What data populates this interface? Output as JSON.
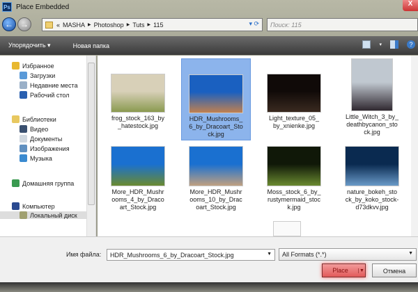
{
  "window": {
    "title": "Place Embedded",
    "app_icon": "Ps",
    "close": "X"
  },
  "address": {
    "crumbs": [
      "«",
      "MASHA",
      "Photoshop",
      "Tuts",
      "115"
    ],
    "search_placeholder": "Поиск: 115"
  },
  "toolbar": {
    "organize": "Упорядочить ▾",
    "new_folder": "Новая папка"
  },
  "sidebar": {
    "items": [
      {
        "label": "Избранное",
        "icon": "star-icon",
        "color": "#e8b830"
      },
      {
        "label": "Загрузки",
        "icon": "downloads-icon",
        "color": "#5a9ad8"
      },
      {
        "label": "Недавние места",
        "icon": "recent-places-icon",
        "color": "#9ab0c8"
      },
      {
        "label": "Рабочий стол",
        "icon": "desktop-icon",
        "color": "#2a60b0"
      },
      {
        "label": "Библиотеки",
        "icon": "libraries-icon",
        "color": "#e8c860"
      },
      {
        "label": "Видео",
        "icon": "video-icon",
        "color": "#3a5070"
      },
      {
        "label": "Документы",
        "icon": "documents-icon",
        "color": "#d0d8e0"
      },
      {
        "label": "Изображения",
        "icon": "pictures-icon",
        "color": "#6090c0"
      },
      {
        "label": "Музыка",
        "icon": "music-icon",
        "color": "#3a8ad0"
      },
      {
        "label": "Домашняя группа",
        "icon": "homegroup-icon",
        "color": "#3a9a50"
      },
      {
        "label": "Компьютер",
        "icon": "computer-icon",
        "color": "#2a4a90"
      },
      {
        "label": "Локальный диск",
        "icon": "local-disk-icon",
        "color": "#a0a070"
      }
    ]
  },
  "files": [
    {
      "name": "frog_stock_163_by _hatestock.jpg",
      "colors": [
        "#d8d0b8",
        "#8a9a50"
      ]
    },
    {
      "name": "HDR_Mushrooms_ 6_by_Dracoart_Sto ck.jpg",
      "colors": [
        "#1a60c0",
        "#c08050"
      ],
      "selected": true
    },
    {
      "name": "Light_texture_05_ by_xnienke.jpg",
      "colors": [
        "#100a08",
        "#3a2a20"
      ]
    },
    {
      "name": "Little_Witch_3_by_ deathbycanon_sto ck.jpg",
      "colors": [
        "#c0c8d0",
        "#302830"
      ]
    },
    {
      "name": "More_HDR_Mushr ooms_4_by_Draco art_Stock.jpg",
      "colors": [
        "#1a70d0",
        "#6a8a30"
      ]
    },
    {
      "name": "More_HDR_Mushr ooms_10_by_Drac oart_Stock.jpg",
      "colors": [
        "#1a70d0",
        "#c0a080"
      ]
    },
    {
      "name": "Moss_stock_6_by_ rustymermaid_stoc k.jpg",
      "colors": [
        "#101808",
        "#6a8a30"
      ]
    },
    {
      "name": "nature_bokeh_sto ck_by_koko_stock- d73dkvv.jpg",
      "colors": [
        "#0a2a50",
        "#6a9ac8"
      ]
    }
  ],
  "bottom": {
    "filename_label": "Имя файла:",
    "filename_value": "HDR_Mushrooms_6_by_Dracoart_Stock.jpg",
    "format": "All Formats (*.*)",
    "place": "Place",
    "cancel": "Отмена"
  }
}
